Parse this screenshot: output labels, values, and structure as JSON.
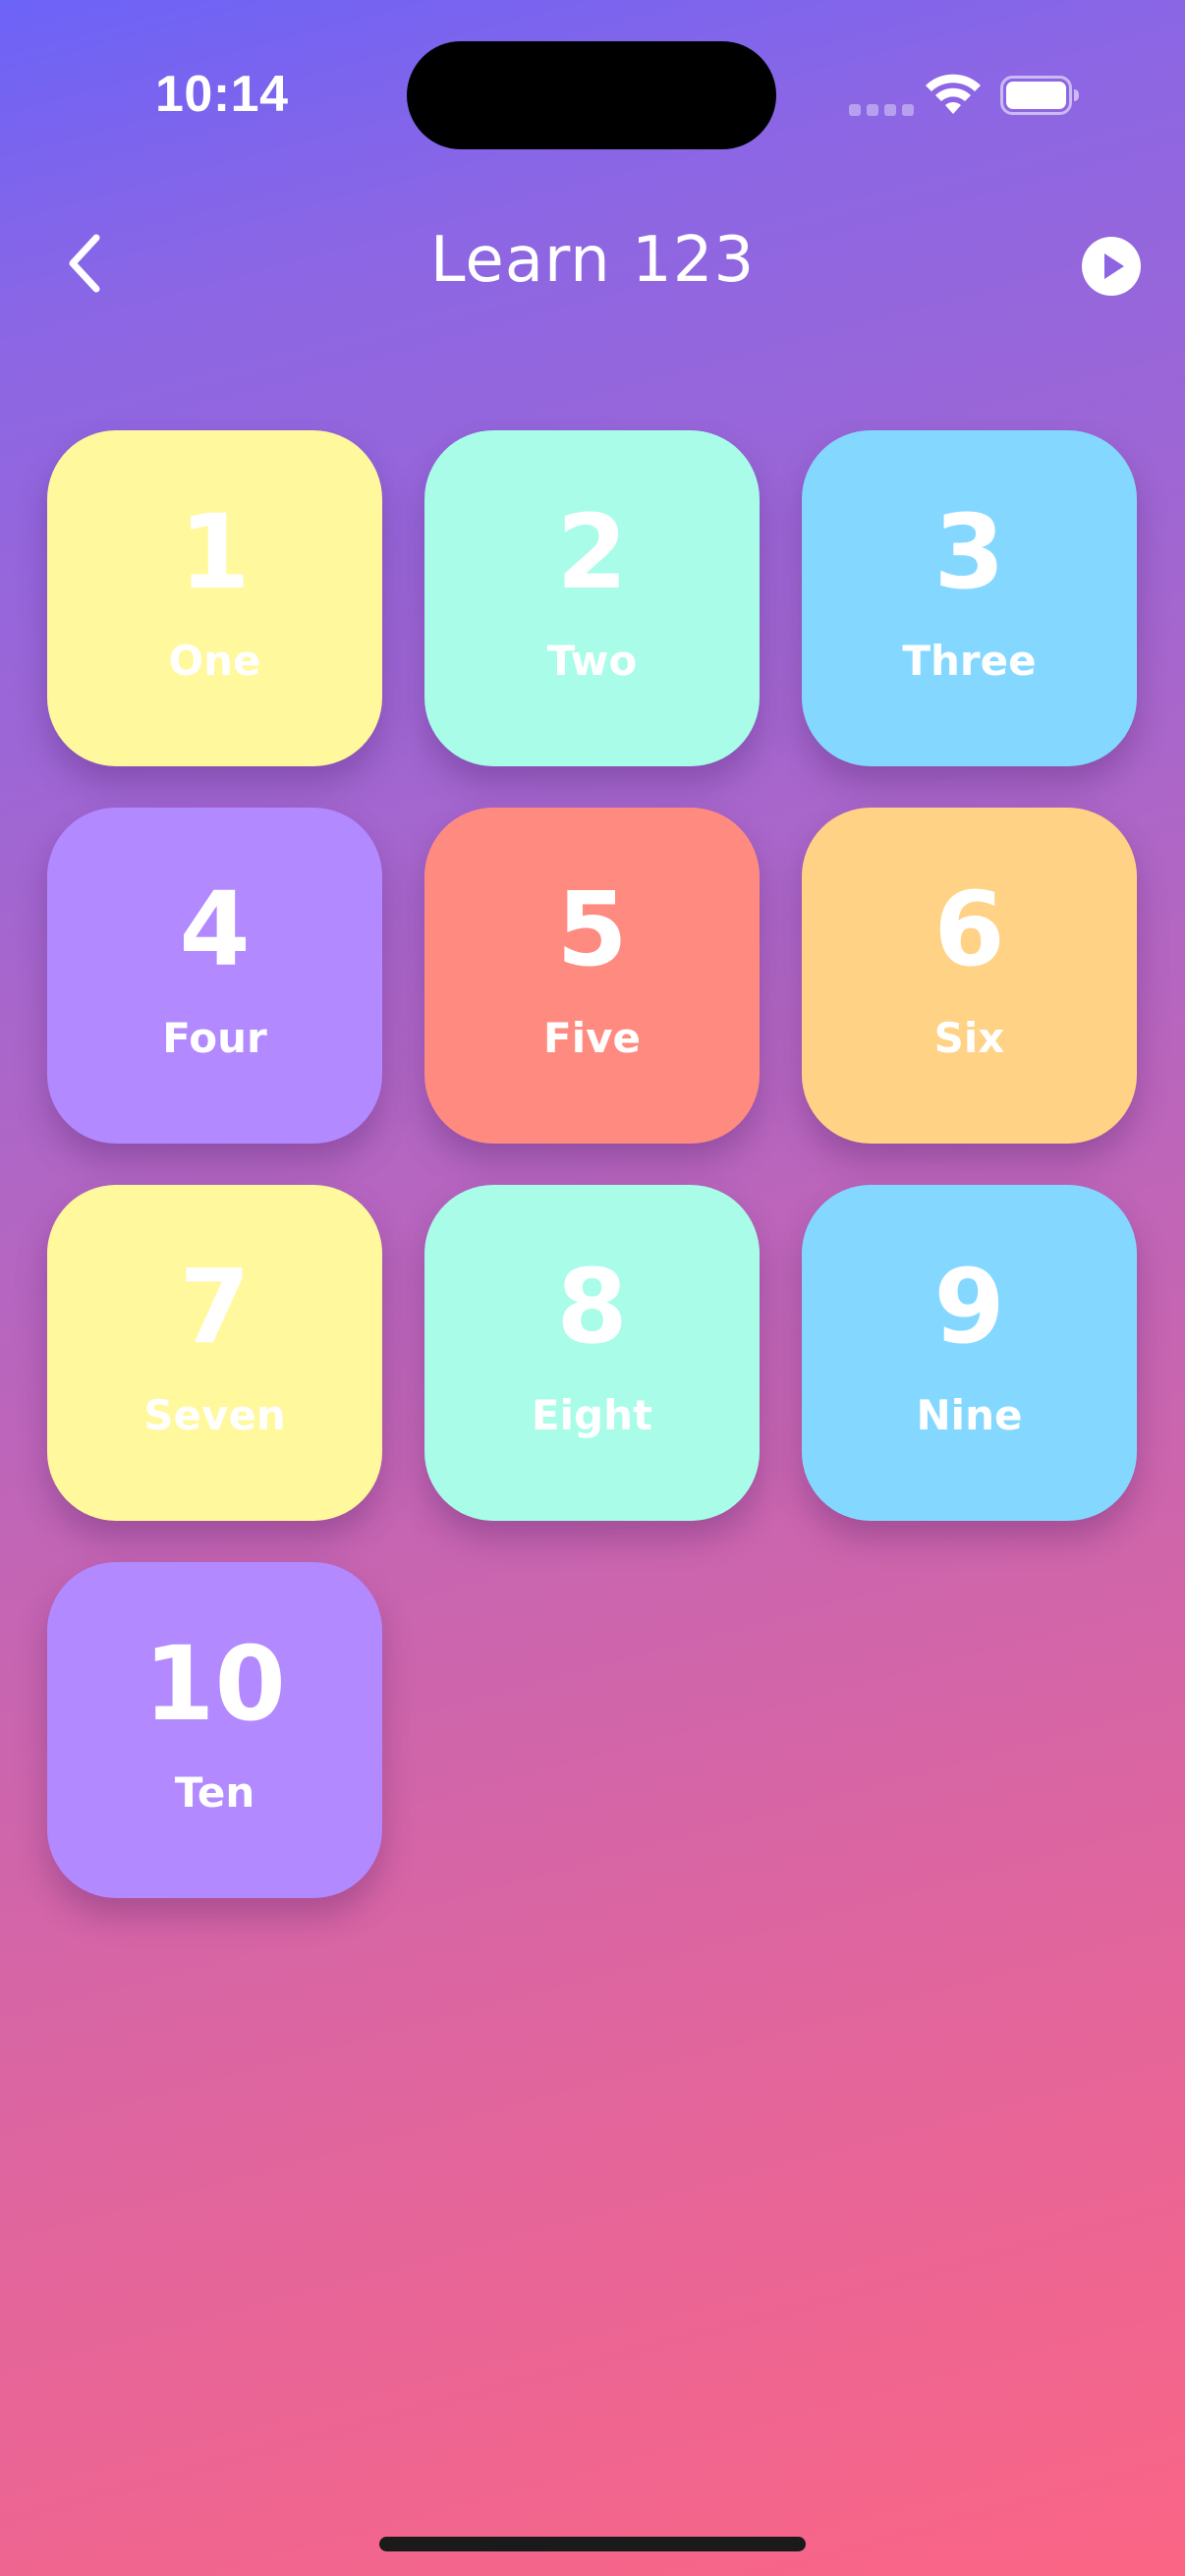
{
  "status_bar": {
    "time": "10:14",
    "wifi_icon": "wifi-icon",
    "battery_icon": "battery-icon"
  },
  "nav": {
    "back_icon": "chevron-left-icon",
    "title": "Learn 123",
    "play_icon": "play-circle-icon"
  },
  "cards": [
    {
      "digit": "1",
      "word": "One",
      "color": "#fff89c"
    },
    {
      "digit": "2",
      "word": "Two",
      "color": "#a8fce8"
    },
    {
      "digit": "3",
      "word": "Three",
      "color": "#84d8ff"
    },
    {
      "digit": "4",
      "word": "Four",
      "color": "#b289fe"
    },
    {
      "digit": "5",
      "word": "Five",
      "color": "#ff8b80"
    },
    {
      "digit": "6",
      "word": "Six",
      "color": "#ffd285"
    },
    {
      "digit": "7",
      "word": "Seven",
      "color": "#fff89c"
    },
    {
      "digit": "8",
      "word": "Eight",
      "color": "#a8fce8"
    },
    {
      "digit": "9",
      "word": "Nine",
      "color": "#84d8ff"
    },
    {
      "digit": "10",
      "word": "Ten",
      "color": "#b289fe"
    }
  ]
}
